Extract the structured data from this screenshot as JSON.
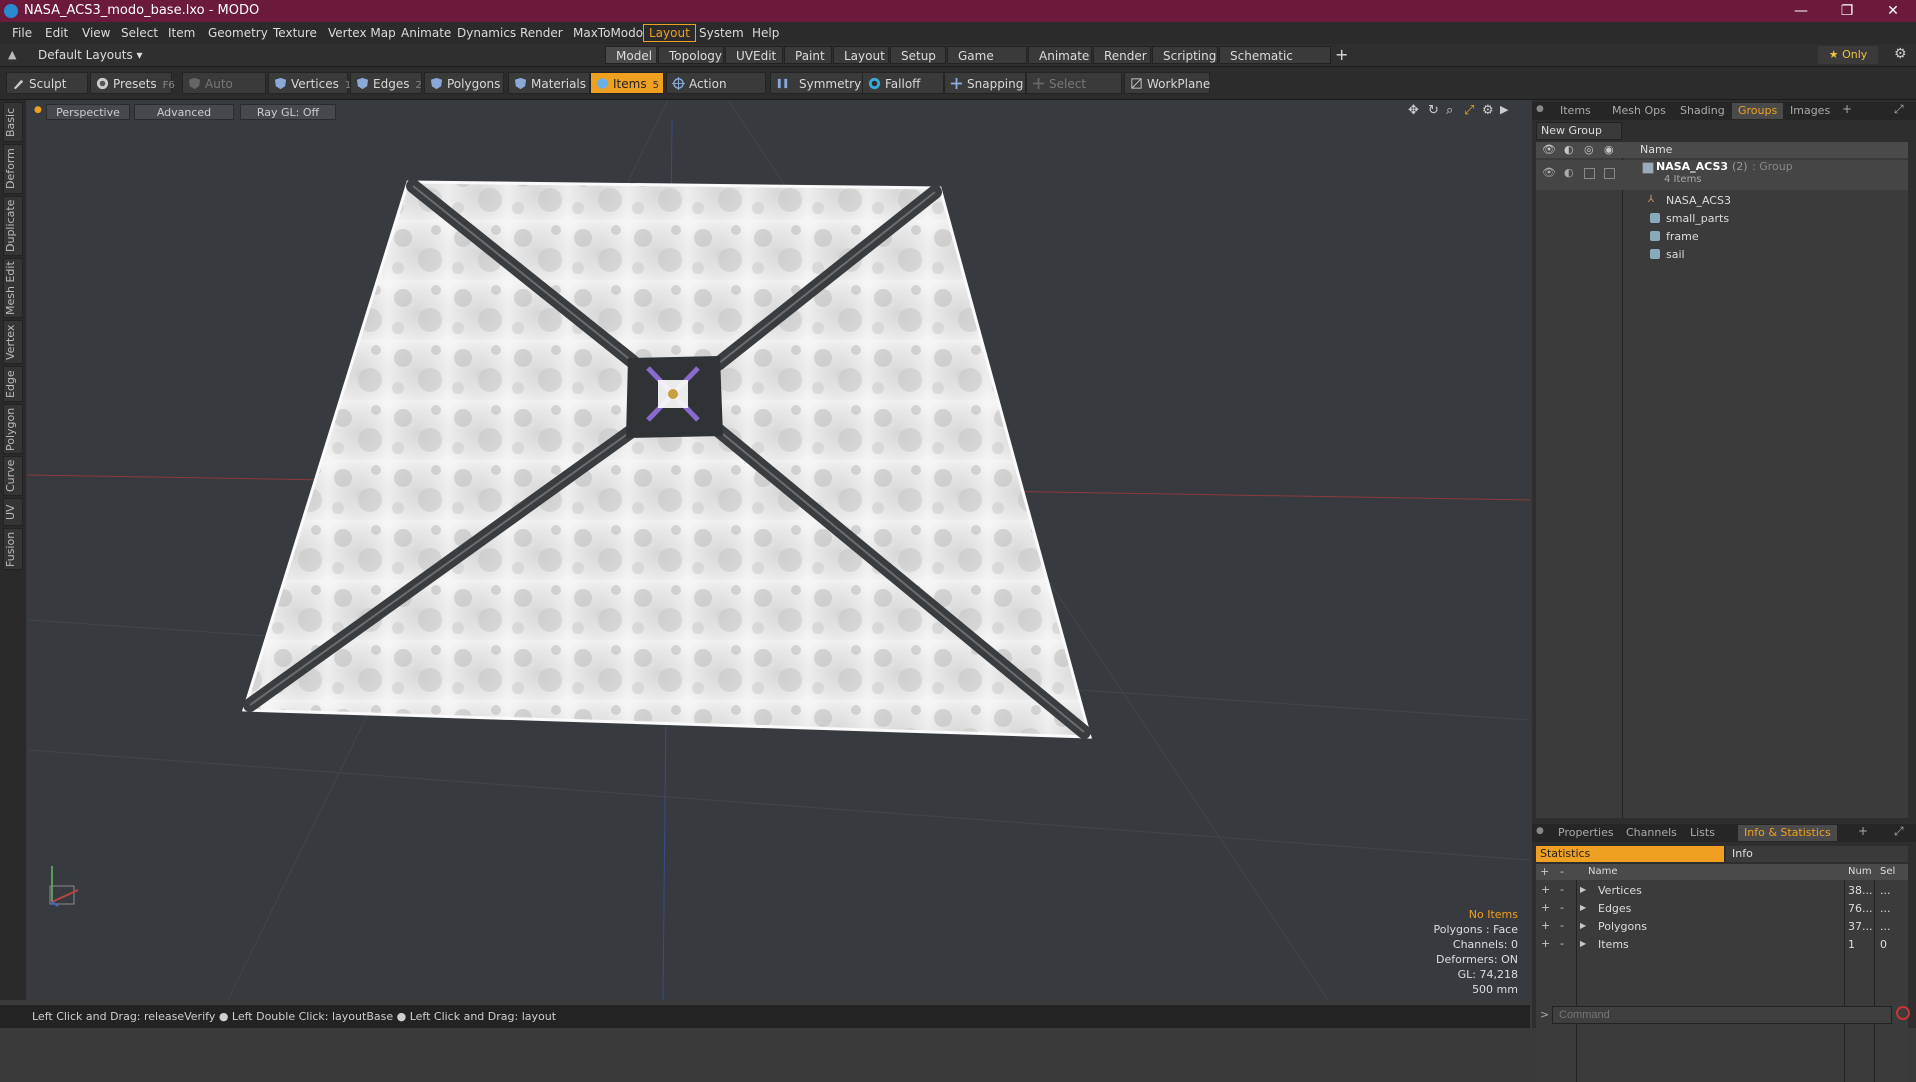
{
  "window": {
    "title": "NASA_ACS3_modo_base.lxo - MODO",
    "minimize": "—",
    "restore": "❐",
    "close": "✕"
  },
  "menu": [
    "File",
    "Edit",
    "View",
    "Select",
    "Item",
    "Geometry",
    "Texture",
    "Vertex Map",
    "Animate",
    "Dynamics",
    "Render",
    "MaxToModo",
    "Layout",
    "System",
    "Help"
  ],
  "active_menu": "Layout",
  "layout_selector": "Default Layouts",
  "layout_tabs": [
    "Model",
    "Topology",
    "UVEdit",
    "Paint",
    "Layout",
    "Setup",
    "Game Tools",
    "Animate",
    "Render",
    "Scripting",
    "Schematic Fusion"
  ],
  "active_layout_tab": "Model",
  "only_label": "★ Only",
  "toolbar": {
    "sculpt": "Sculpt",
    "presets": "Presets",
    "presets_key": "F6",
    "auto_select": "Auto Select",
    "vertices": "Vertices",
    "vertices_num": "1",
    "edges": "Edges",
    "edges_num": "2",
    "polygons": "Polygons",
    "materials": "Materials",
    "items": "Items",
    "items_num": "5",
    "action_center": "Action Center",
    "symmetry": "Symmetry",
    "falloff": "Falloff",
    "snapping": "Snapping",
    "select_through": "Select Through",
    "workplane": "WorkPlane"
  },
  "left_tabs": [
    "Basic",
    "Deform",
    "Duplicate",
    "Mesh Edit",
    "Vertex",
    "Edge",
    "Polygon",
    "Curve",
    "UV",
    "Fusion"
  ],
  "viewport": {
    "view": "Perspective",
    "shading": "Advanced",
    "raygl": "Ray GL: Off",
    "info": {
      "selection": "No Items",
      "polygons": "Polygons : Face",
      "channels": "Channels: 0",
      "deformers": "Deformers: ON",
      "gl": "GL: 74,218",
      "scale": "500 mm"
    }
  },
  "status_text": "Left Click and Drag: releaseVerify ● Left Double Click: layoutBase ● Left Click and Drag: layout",
  "top_panel": {
    "tabs": [
      "Items",
      "Mesh Ops",
      "Shading",
      "Groups",
      "Images"
    ],
    "active_tab": "Groups",
    "new_group": "New Group",
    "name_header": "Name",
    "group": {
      "name": "NASA_ACS3",
      "count": "(2)",
      "type": ": Group",
      "sub": "4 Items"
    },
    "children": [
      "NASA_ACS3",
      "small_parts",
      "frame",
      "sail"
    ]
  },
  "bottom_panel": {
    "tabs": [
      "Properties",
      "Channels",
      "Lists",
      "Info & Statistics"
    ],
    "active_tab": "Info & Statistics",
    "sub_tabs": [
      "Statistics",
      "Info"
    ],
    "headers": {
      "name": "Name",
      "num": "Num",
      "sel": "Sel"
    },
    "rows": [
      {
        "name": "Vertices",
        "num": "38...",
        "sel": "..."
      },
      {
        "name": "Edges",
        "num": "76...",
        "sel": "..."
      },
      {
        "name": "Polygons",
        "num": "37...",
        "sel": "..."
      },
      {
        "name": "Items",
        "num": "1",
        "sel": "0"
      }
    ]
  },
  "command_placeholder": "Command"
}
